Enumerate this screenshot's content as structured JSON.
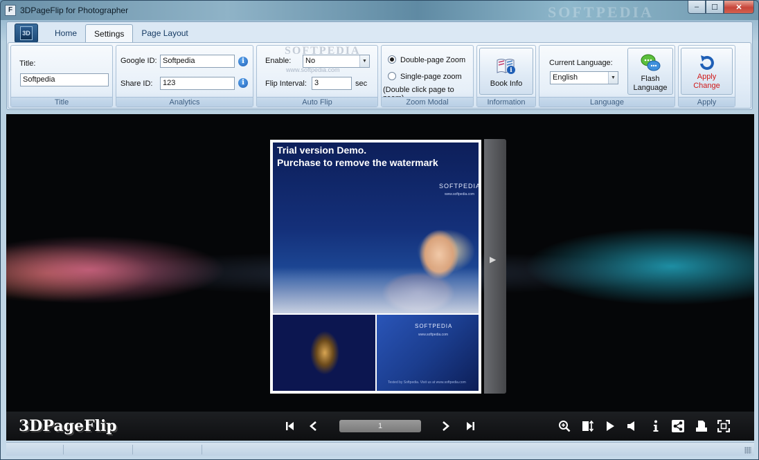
{
  "window": {
    "title": "3DPageFlip for Photographer",
    "watermark": "SOFTPEDIA",
    "controls": {
      "minimize": "–",
      "maximize": "☐",
      "close": "✕"
    }
  },
  "app_button": {
    "label": "3D"
  },
  "tabs": [
    {
      "label": "Home",
      "active": false
    },
    {
      "label": "Settings",
      "active": true
    },
    {
      "label": "Page Layout",
      "active": false
    }
  ],
  "groups": {
    "title": {
      "label": "Title",
      "field_label": "Title:",
      "value": "Softpedia"
    },
    "analytics": {
      "label": "Analytics",
      "google_label": "Google ID:",
      "google_value": "Softpedia",
      "share_label": "Share ID:",
      "share_value": "123"
    },
    "auto_flip": {
      "label": "Auto Flip",
      "enable_label": "Enable:",
      "enable_value": "No",
      "interval_label": "Flip Interval:",
      "interval_value": "3",
      "interval_unit": "sec",
      "watermark": "SOFTPEDIA",
      "watermark_url": "www.softpedia.com"
    },
    "zoom_modal": {
      "label": "Zoom Modal",
      "double_label": "Double-page Zoom",
      "single_label": "Single-page zoom",
      "note": "(Double click page to zoom)",
      "selected": "double"
    },
    "information": {
      "label": "Information",
      "button_label": "Book Info"
    },
    "language": {
      "label": "Language",
      "current_label": "Current Language:",
      "current_value": "English",
      "flash_line1": "Flash",
      "flash_line2": "Language"
    },
    "apply": {
      "label": "Apply",
      "line1": "Apply",
      "line2": "Change",
      "color": "#d01818"
    }
  },
  "book": {
    "trial_line1": "Trial version Demo.",
    "trial_line2": "Purchase to remove the watermark",
    "page_logo": "SOFTPEDIA",
    "page_url": "www.softpedia.com",
    "panel_logo": "SOFTPEDIA",
    "panel_url": "www.softpedia.com",
    "footer_text": "Tested by Softpedia. Visit us at www.softpedia.com"
  },
  "player": {
    "brand": "3DPageFlip",
    "page_number": "1",
    "icons": [
      "first-page-icon",
      "prev-page-icon",
      "next-page-icon",
      "last-page-icon",
      "zoom-in-icon",
      "fit-icon",
      "autoplay-icon",
      "sound-icon",
      "info-icon",
      "share-icon",
      "print-icon",
      "fullscreen-icon"
    ]
  },
  "colors": {
    "accent": "#153a63",
    "stage_bg": "#050608",
    "toolbar_bg": "#141517"
  }
}
